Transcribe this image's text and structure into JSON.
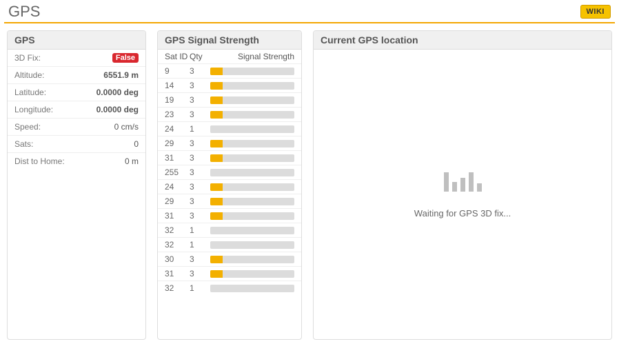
{
  "header": {
    "title": "GPS",
    "wiki": "WIKI"
  },
  "gps": {
    "panel_title": "GPS",
    "rows": [
      {
        "label": "3D Fix:",
        "value": "False",
        "badge": true
      },
      {
        "label": "Altitude:",
        "value": "6551.9 m",
        "bold": true
      },
      {
        "label": "Latitude:",
        "value": "0.0000 deg",
        "bold": true
      },
      {
        "label": "Longitude:",
        "value": "0.0000 deg",
        "bold": true
      },
      {
        "label": "Speed:",
        "value": "0 cm/s",
        "bold": false
      },
      {
        "label": "Sats:",
        "value": "0",
        "bold": false
      },
      {
        "label": "Dist to Home:",
        "value": "0 m",
        "bold": false
      }
    ]
  },
  "signal": {
    "panel_title": "GPS Signal Strength",
    "header": {
      "satid": "Sat ID",
      "qty": "Qty",
      "strength": "Signal Strength"
    },
    "sats": [
      {
        "id": 9,
        "qty": 3,
        "pct": 15
      },
      {
        "id": 14,
        "qty": 3,
        "pct": 15
      },
      {
        "id": 19,
        "qty": 3,
        "pct": 15
      },
      {
        "id": 23,
        "qty": 3,
        "pct": 15
      },
      {
        "id": 24,
        "qty": 1,
        "pct": 0
      },
      {
        "id": 29,
        "qty": 3,
        "pct": 15
      },
      {
        "id": 31,
        "qty": 3,
        "pct": 15
      },
      {
        "id": 255,
        "qty": 3,
        "pct": 0
      },
      {
        "id": 24,
        "qty": 3,
        "pct": 15
      },
      {
        "id": 29,
        "qty": 3,
        "pct": 15
      },
      {
        "id": 31,
        "qty": 3,
        "pct": 15
      },
      {
        "id": 32,
        "qty": 1,
        "pct": 0
      },
      {
        "id": 32,
        "qty": 1,
        "pct": 0
      },
      {
        "id": 30,
        "qty": 3,
        "pct": 15
      },
      {
        "id": 31,
        "qty": 3,
        "pct": 15
      },
      {
        "id": 32,
        "qty": 1,
        "pct": 0
      }
    ]
  },
  "location": {
    "panel_title": "Current GPS location",
    "waiting": "Waiting for GPS 3D fix..."
  }
}
